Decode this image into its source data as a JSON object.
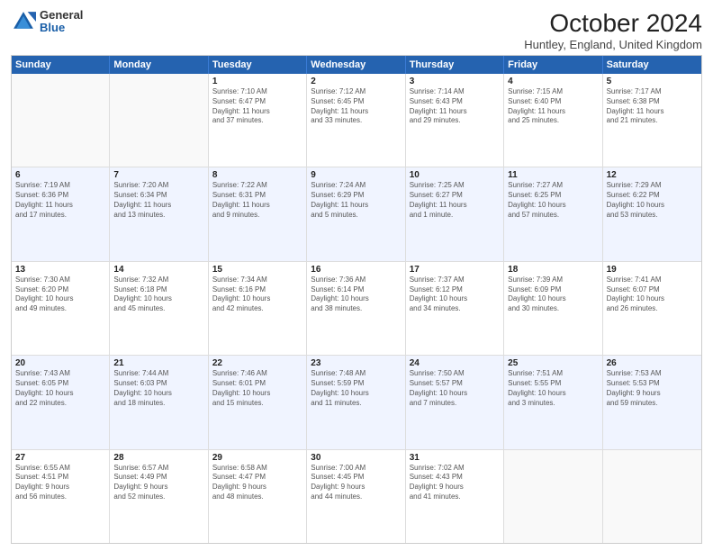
{
  "header": {
    "logo_general": "General",
    "logo_blue": "Blue",
    "month_title": "October 2024",
    "subtitle": "Huntley, England, United Kingdom"
  },
  "weekdays": [
    "Sunday",
    "Monday",
    "Tuesday",
    "Wednesday",
    "Thursday",
    "Friday",
    "Saturday"
  ],
  "rows": [
    [
      {
        "day": "",
        "lines": [],
        "empty": true
      },
      {
        "day": "",
        "lines": [],
        "empty": true
      },
      {
        "day": "1",
        "lines": [
          "Sunrise: 7:10 AM",
          "Sunset: 6:47 PM",
          "Daylight: 11 hours",
          "and 37 minutes."
        ]
      },
      {
        "day": "2",
        "lines": [
          "Sunrise: 7:12 AM",
          "Sunset: 6:45 PM",
          "Daylight: 11 hours",
          "and 33 minutes."
        ]
      },
      {
        "day": "3",
        "lines": [
          "Sunrise: 7:14 AM",
          "Sunset: 6:43 PM",
          "Daylight: 11 hours",
          "and 29 minutes."
        ]
      },
      {
        "day": "4",
        "lines": [
          "Sunrise: 7:15 AM",
          "Sunset: 6:40 PM",
          "Daylight: 11 hours",
          "and 25 minutes."
        ]
      },
      {
        "day": "5",
        "lines": [
          "Sunrise: 7:17 AM",
          "Sunset: 6:38 PM",
          "Daylight: 11 hours",
          "and 21 minutes."
        ]
      }
    ],
    [
      {
        "day": "6",
        "lines": [
          "Sunrise: 7:19 AM",
          "Sunset: 6:36 PM",
          "Daylight: 11 hours",
          "and 17 minutes."
        ]
      },
      {
        "day": "7",
        "lines": [
          "Sunrise: 7:20 AM",
          "Sunset: 6:34 PM",
          "Daylight: 11 hours",
          "and 13 minutes."
        ]
      },
      {
        "day": "8",
        "lines": [
          "Sunrise: 7:22 AM",
          "Sunset: 6:31 PM",
          "Daylight: 11 hours",
          "and 9 minutes."
        ]
      },
      {
        "day": "9",
        "lines": [
          "Sunrise: 7:24 AM",
          "Sunset: 6:29 PM",
          "Daylight: 11 hours",
          "and 5 minutes."
        ]
      },
      {
        "day": "10",
        "lines": [
          "Sunrise: 7:25 AM",
          "Sunset: 6:27 PM",
          "Daylight: 11 hours",
          "and 1 minute."
        ]
      },
      {
        "day": "11",
        "lines": [
          "Sunrise: 7:27 AM",
          "Sunset: 6:25 PM",
          "Daylight: 10 hours",
          "and 57 minutes."
        ]
      },
      {
        "day": "12",
        "lines": [
          "Sunrise: 7:29 AM",
          "Sunset: 6:22 PM",
          "Daylight: 10 hours",
          "and 53 minutes."
        ]
      }
    ],
    [
      {
        "day": "13",
        "lines": [
          "Sunrise: 7:30 AM",
          "Sunset: 6:20 PM",
          "Daylight: 10 hours",
          "and 49 minutes."
        ]
      },
      {
        "day": "14",
        "lines": [
          "Sunrise: 7:32 AM",
          "Sunset: 6:18 PM",
          "Daylight: 10 hours",
          "and 45 minutes."
        ]
      },
      {
        "day": "15",
        "lines": [
          "Sunrise: 7:34 AM",
          "Sunset: 6:16 PM",
          "Daylight: 10 hours",
          "and 42 minutes."
        ]
      },
      {
        "day": "16",
        "lines": [
          "Sunrise: 7:36 AM",
          "Sunset: 6:14 PM",
          "Daylight: 10 hours",
          "and 38 minutes."
        ]
      },
      {
        "day": "17",
        "lines": [
          "Sunrise: 7:37 AM",
          "Sunset: 6:12 PM",
          "Daylight: 10 hours",
          "and 34 minutes."
        ]
      },
      {
        "day": "18",
        "lines": [
          "Sunrise: 7:39 AM",
          "Sunset: 6:09 PM",
          "Daylight: 10 hours",
          "and 30 minutes."
        ]
      },
      {
        "day": "19",
        "lines": [
          "Sunrise: 7:41 AM",
          "Sunset: 6:07 PM",
          "Daylight: 10 hours",
          "and 26 minutes."
        ]
      }
    ],
    [
      {
        "day": "20",
        "lines": [
          "Sunrise: 7:43 AM",
          "Sunset: 6:05 PM",
          "Daylight: 10 hours",
          "and 22 minutes."
        ]
      },
      {
        "day": "21",
        "lines": [
          "Sunrise: 7:44 AM",
          "Sunset: 6:03 PM",
          "Daylight: 10 hours",
          "and 18 minutes."
        ]
      },
      {
        "day": "22",
        "lines": [
          "Sunrise: 7:46 AM",
          "Sunset: 6:01 PM",
          "Daylight: 10 hours",
          "and 15 minutes."
        ]
      },
      {
        "day": "23",
        "lines": [
          "Sunrise: 7:48 AM",
          "Sunset: 5:59 PM",
          "Daylight: 10 hours",
          "and 11 minutes."
        ]
      },
      {
        "day": "24",
        "lines": [
          "Sunrise: 7:50 AM",
          "Sunset: 5:57 PM",
          "Daylight: 10 hours",
          "and 7 minutes."
        ]
      },
      {
        "day": "25",
        "lines": [
          "Sunrise: 7:51 AM",
          "Sunset: 5:55 PM",
          "Daylight: 10 hours",
          "and 3 minutes."
        ]
      },
      {
        "day": "26",
        "lines": [
          "Sunrise: 7:53 AM",
          "Sunset: 5:53 PM",
          "Daylight: 9 hours",
          "and 59 minutes."
        ]
      }
    ],
    [
      {
        "day": "27",
        "lines": [
          "Sunrise: 6:55 AM",
          "Sunset: 4:51 PM",
          "Daylight: 9 hours",
          "and 56 minutes."
        ]
      },
      {
        "day": "28",
        "lines": [
          "Sunrise: 6:57 AM",
          "Sunset: 4:49 PM",
          "Daylight: 9 hours",
          "and 52 minutes."
        ]
      },
      {
        "day": "29",
        "lines": [
          "Sunrise: 6:58 AM",
          "Sunset: 4:47 PM",
          "Daylight: 9 hours",
          "and 48 minutes."
        ]
      },
      {
        "day": "30",
        "lines": [
          "Sunrise: 7:00 AM",
          "Sunset: 4:45 PM",
          "Daylight: 9 hours",
          "and 44 minutes."
        ]
      },
      {
        "day": "31",
        "lines": [
          "Sunrise: 7:02 AM",
          "Sunset: 4:43 PM",
          "Daylight: 9 hours",
          "and 41 minutes."
        ]
      },
      {
        "day": "",
        "lines": [],
        "empty": true
      },
      {
        "day": "",
        "lines": [],
        "empty": true
      }
    ]
  ]
}
